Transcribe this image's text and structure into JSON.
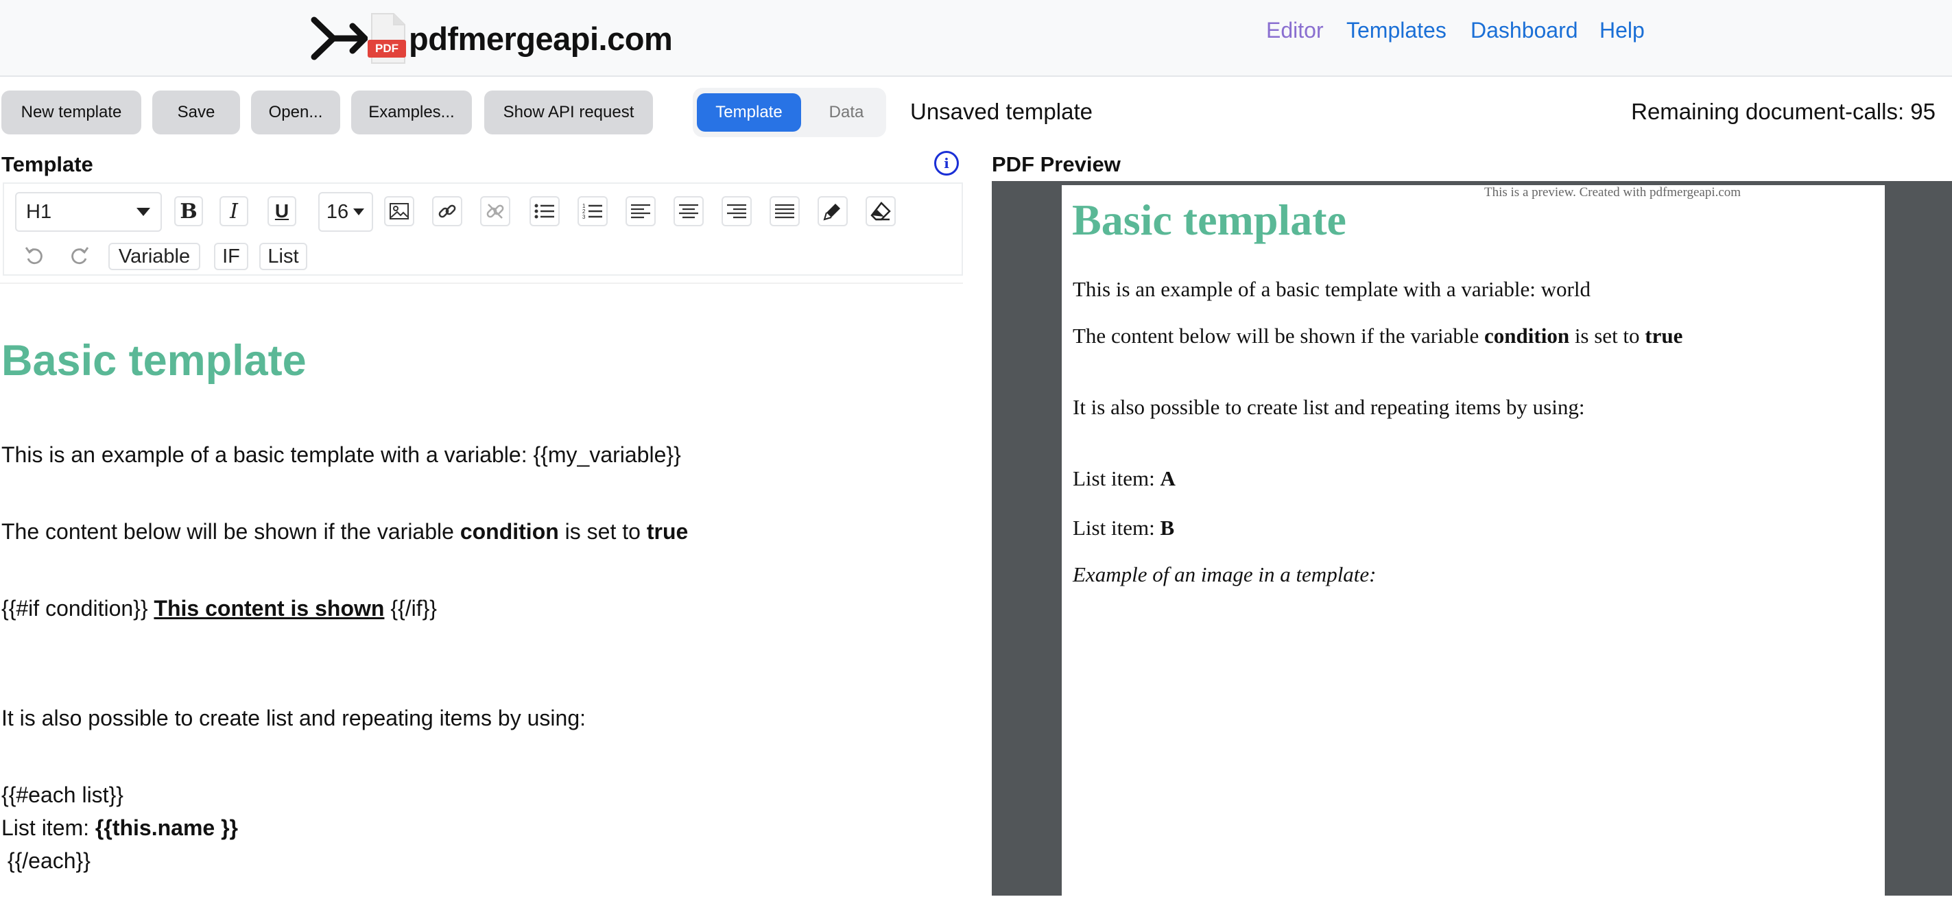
{
  "brand": {
    "logo_text": "pdfmergeapi.com",
    "logo_badge": "PDF"
  },
  "nav": [
    {
      "label": "Editor",
      "active": true
    },
    {
      "label": "Templates",
      "active": false
    },
    {
      "label": "Dashboard",
      "active": false
    },
    {
      "label": "Help",
      "active": false
    }
  ],
  "actions": {
    "new_template": "New template",
    "save": "Save",
    "open": "Open...",
    "examples": "Examples...",
    "show_api": "Show API request"
  },
  "mode_toggle": {
    "template": "Template",
    "data": "Data",
    "selected": "Template"
  },
  "status": {
    "unsaved": "Unsaved template",
    "remaining": "Remaining document-calls: 95"
  },
  "template_panel": {
    "heading": "Template",
    "toolbar": {
      "block_style": "H1",
      "font_size": "16",
      "variable_button": "Variable",
      "if_button": "IF",
      "list_button": "List",
      "icons": [
        "bold-icon",
        "italic-icon",
        "underline-icon",
        "image-icon",
        "link-icon",
        "unlink-icon",
        "bullet-list-icon",
        "numbered-list-icon",
        "align-left-icon",
        "align-center-icon",
        "align-right-icon",
        "align-justify-icon",
        "highlighter-icon",
        "eraser-icon",
        "undo-icon",
        "redo-icon"
      ]
    },
    "content": {
      "title": "Basic template",
      "line1": "This is an example of a basic template with a variable: {{my_variable}}",
      "line2_a": "The content below will be shown if the variable ",
      "line2_b": "condition",
      "line2_c": " is set to ",
      "line2_d": "true",
      "line3_a": "{{#if condition}} ",
      "line3_b": "This content is shown",
      "line3_c": " {{/if}}",
      "line4": "It is also possible to create list and repeating items by using:",
      "line5": "{{#each list}}",
      "line6_a": "List item: ",
      "line6_b": "{{this.name }}",
      "line7": " {{/each}}"
    }
  },
  "preview_panel": {
    "heading": "PDF Preview",
    "note": "This is a preview. Created with pdfmergeapi.com",
    "title": "Basic template",
    "line1": "This is an example of a basic template with a variable: world",
    "line2_a": "The content below will be shown if the variable ",
    "line2_b": "condition",
    "line2_c": " is set to ",
    "line2_d": "true",
    "line3": "It is also possible to create list and repeating items by using:",
    "item_prefix": "List item: ",
    "item_a": "A",
    "item_b": "B",
    "image_caption": "Example of an image in a template:"
  },
  "colors": {
    "accent": "#2873e5",
    "heading_green": "#5ab896",
    "nav_link": "#1a6fd6",
    "nav_active": "#8a6fd0",
    "pdf_viewer_bg": "#525659"
  }
}
